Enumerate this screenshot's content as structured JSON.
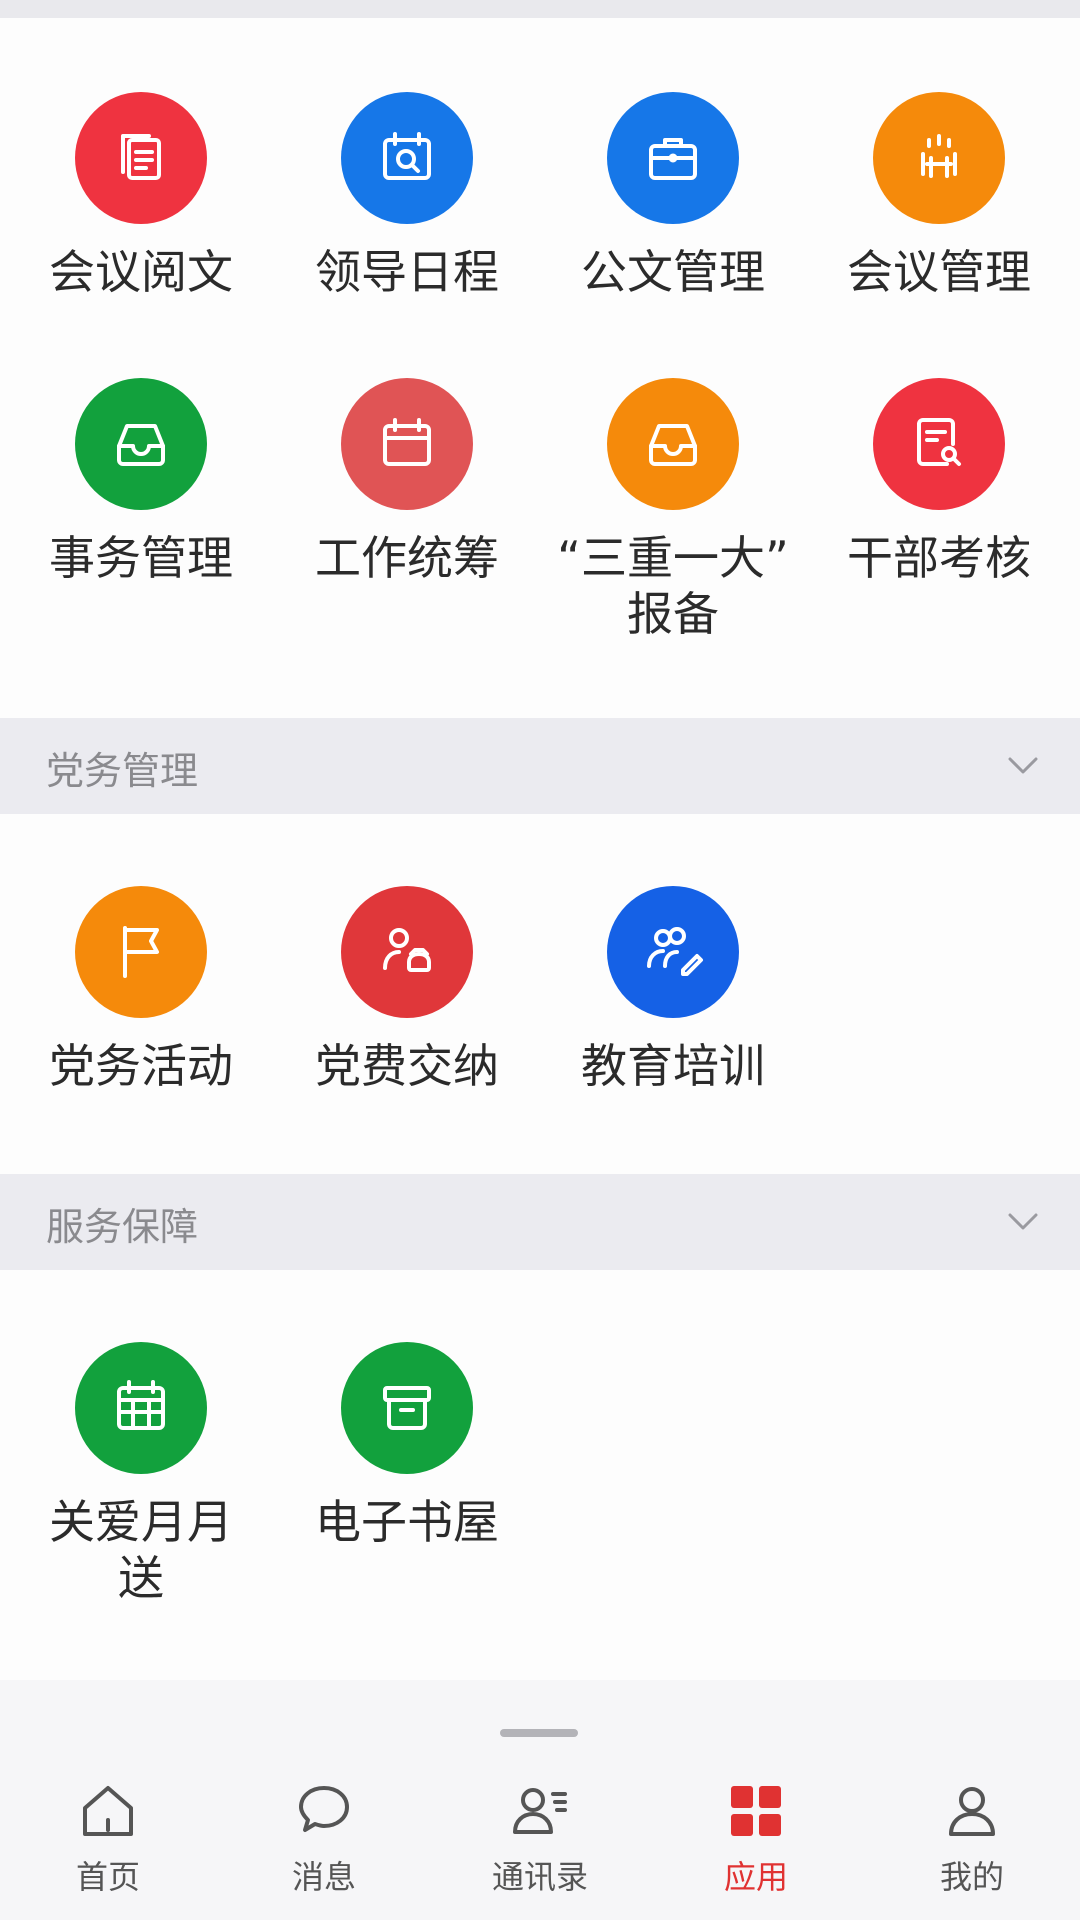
{
  "colors": {
    "red": "#ef3340",
    "blue": "#1677e8",
    "orange": "#f58a0b",
    "green": "#12a13d",
    "salmon": "#e05455",
    "active_tab": "#e03232"
  },
  "office_apps": [
    {
      "label": "会议阅文",
      "icon": "document-stack-icon",
      "color": "red"
    },
    {
      "label": "领导日程",
      "icon": "calendar-search-icon",
      "color": "blue"
    },
    {
      "label": "公文管理",
      "icon": "briefcase-icon",
      "color": "blue"
    },
    {
      "label": "会议管理",
      "icon": "meeting-table-icon",
      "color": "orange"
    },
    {
      "label": "事务管理",
      "icon": "inbox-tray-icon",
      "color": "green"
    },
    {
      "label": "工作统筹",
      "icon": "calendar-icon",
      "color": "salmon"
    },
    {
      "label": "“三重一大”\n报备",
      "icon": "inbox-tray-icon",
      "color": "orange"
    },
    {
      "label": "干部考核",
      "icon": "document-search-icon",
      "color": "red"
    }
  ],
  "party_section": {
    "title": "党务管理",
    "apps": [
      {
        "label": "党务活动",
        "icon": "flag-icon",
        "color": "orange"
      },
      {
        "label": "党费交纳",
        "icon": "user-moneybag-icon",
        "color": "red"
      },
      {
        "label": "教育培训",
        "icon": "users-edit-icon",
        "color": "blue"
      }
    ]
  },
  "service_section": {
    "title": "服务保障",
    "apps": [
      {
        "label": "关爱月月\n送",
        "icon": "calendar-grid-icon",
        "color": "green"
      },
      {
        "label": "电子书屋",
        "icon": "archive-box-icon",
        "color": "green"
      }
    ]
  },
  "bottom_nav": [
    {
      "label": "首页",
      "icon": "home-icon",
      "active": false
    },
    {
      "label": "消息",
      "icon": "chat-bubble-icon",
      "active": false
    },
    {
      "label": "通讯录",
      "icon": "contacts-icon",
      "active": false
    },
    {
      "label": "应用",
      "icon": "apps-grid-icon",
      "active": true
    },
    {
      "label": "我的",
      "icon": "user-icon",
      "active": false
    }
  ]
}
